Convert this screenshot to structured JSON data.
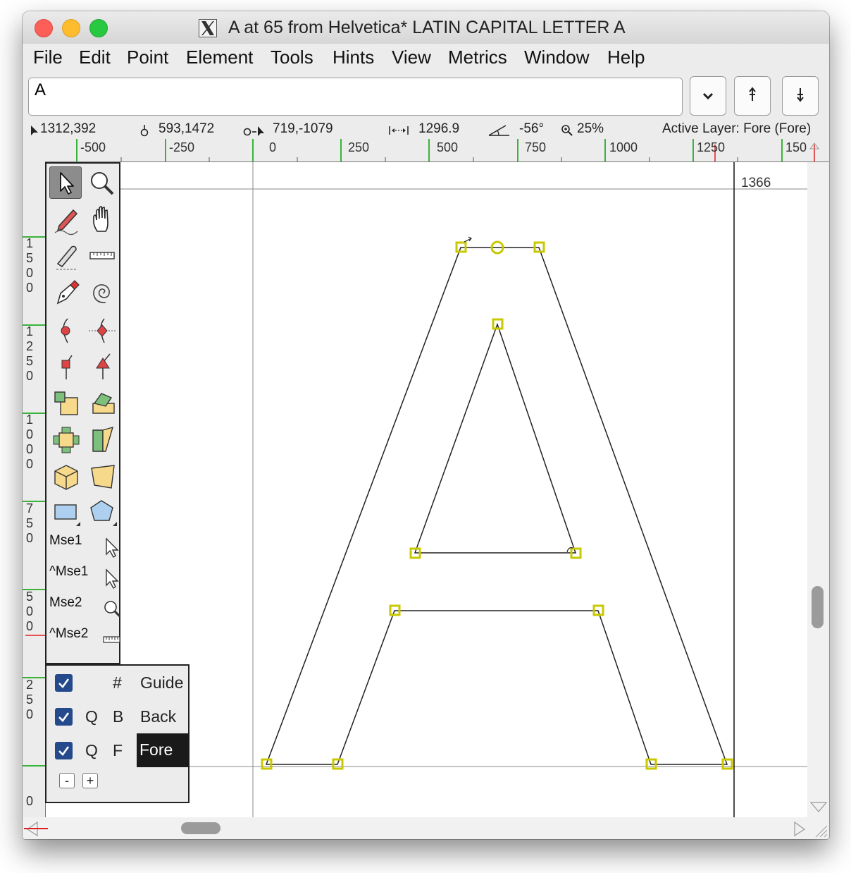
{
  "window": {
    "title": "A at 65 from Helvetica* LATIN CAPITAL LETTER A"
  },
  "menu": [
    "File",
    "Edit",
    "Point",
    "Element",
    "Tools",
    "Hints",
    "View",
    "Metrics",
    "Window",
    "Help"
  ],
  "glyph_field": {
    "value": "A"
  },
  "info_bar": {
    "cursor": "1312,392",
    "point": "593,1472",
    "delta": "719,-1079",
    "distance": "1296.9",
    "angle": "-56°",
    "zoom": "25%",
    "active_layer": "Active Layer: Fore (Fore)"
  },
  "h_ruler_labels": [
    "-500",
    "-250",
    "0",
    "250",
    "500",
    "750",
    "1000",
    "1250",
    "150"
  ],
  "v_ruler_labels": [
    "1500",
    "1250",
    "1000",
    "750",
    "500",
    "250",
    "0"
  ],
  "canvas": {
    "advance_width_label": "1366"
  },
  "mouse_bindings": [
    "Mse1",
    "^Mse1",
    "Mse2",
    "^Mse2"
  ],
  "layers": [
    {
      "q": "",
      "key": "#",
      "name": "Guide",
      "checked": true
    },
    {
      "q": "Q",
      "key": "B",
      "name": "Back",
      "checked": true
    },
    {
      "q": "Q",
      "key": "F",
      "name": "Fore",
      "checked": true
    }
  ],
  "layer_buttons": {
    "minus": "-",
    "plus": "+"
  },
  "icons": {
    "guide_color": "#00a000",
    "point_color": "#c8c800",
    "selected_layer_bg": "#1a1a1a",
    "checkbox_color": "#254a8c"
  }
}
